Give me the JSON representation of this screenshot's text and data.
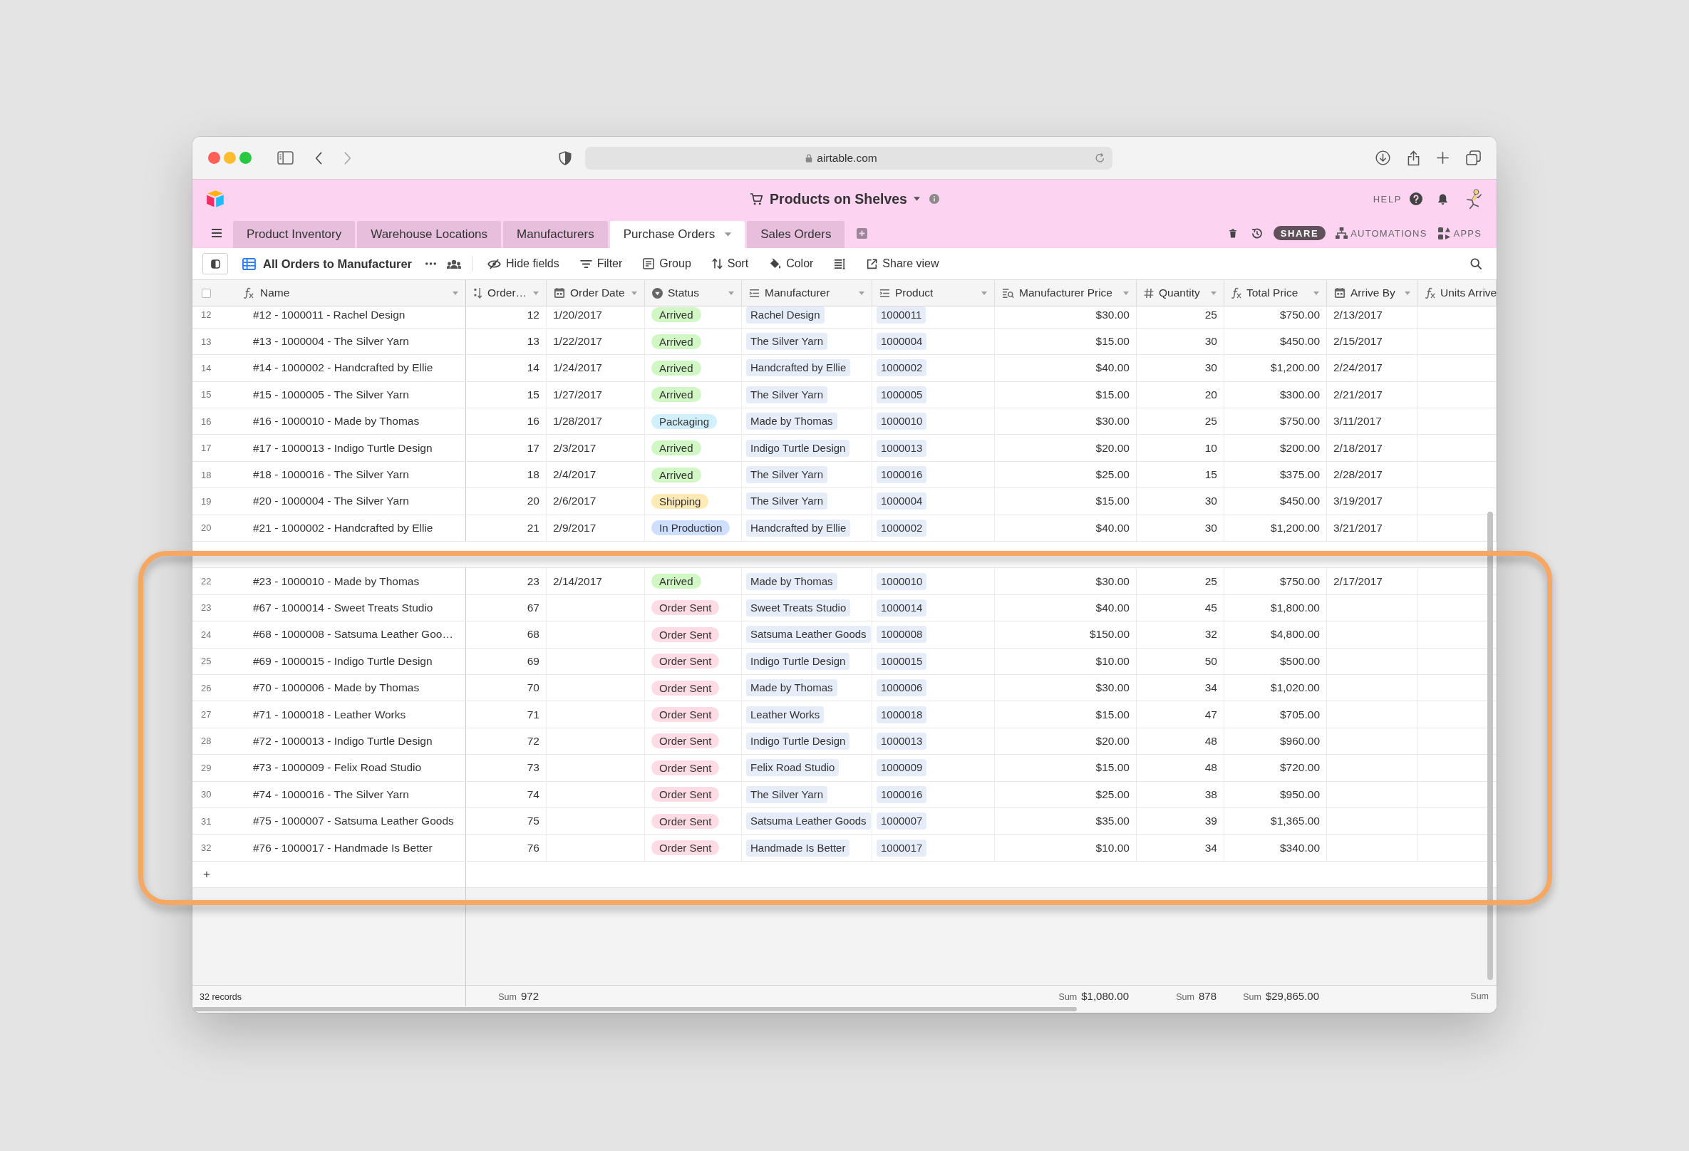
{
  "browser": {
    "url": "airtable.com"
  },
  "header": {
    "title": "Products on Shelves",
    "help": "HELP",
    "share": "SHARE",
    "automations": "AUTOMATIONS",
    "apps": "APPS"
  },
  "tabs": [
    {
      "label": "Product Inventory",
      "selected": false
    },
    {
      "label": "Warehouse Locations",
      "selected": false
    },
    {
      "label": "Manufacturers",
      "selected": false
    },
    {
      "label": "Purchase Orders",
      "selected": true
    },
    {
      "label": "Sales Orders",
      "selected": false
    }
  ],
  "toolbar": {
    "view_name": "All Orders to Manufacturer",
    "buttons": [
      {
        "kind": "hide",
        "label": "Hide fields"
      },
      {
        "kind": "filter",
        "label": "Filter"
      },
      {
        "kind": "group",
        "label": "Group"
      },
      {
        "kind": "sort",
        "label": "Sort"
      },
      {
        "kind": "color",
        "label": "Color"
      },
      {
        "kind": "rowheight"
      },
      {
        "kind": "share",
        "label": "Share view"
      }
    ]
  },
  "table": {
    "select_all": {
      "checked": false
    },
    "columns": [
      {
        "label": "Name",
        "kind": "formula"
      },
      {
        "label": "Order…",
        "kind": "autonumber"
      },
      {
        "label": "Order Date",
        "kind": "date"
      },
      {
        "label": "Status",
        "kind": "select"
      },
      {
        "label": "Manufacturer",
        "kind": "link"
      },
      {
        "label": "Product",
        "kind": "link"
      },
      {
        "label": "Manufacturer Price",
        "kind": "lookup"
      },
      {
        "label": "Quantity",
        "kind": "number"
      },
      {
        "label": "Total Price",
        "kind": "formula"
      },
      {
        "label": "Arrive By",
        "kind": "date"
      },
      {
        "label": "Units Arrive",
        "kind": "formula"
      }
    ],
    "rows": [
      {
        "number": "12",
        "name": "#12 - 1000011 - Rachel Design",
        "order": "12",
        "order_date": "1/20/2017",
        "status": {
          "label": "Arrived",
          "color": "#d1f7c4"
        },
        "manufacturer": "Rachel Design",
        "product": "1000011",
        "manufacturer_price": "$30.00",
        "quantity": "25",
        "total_price": "$750.00",
        "arrive_by": "2/13/2017"
      },
      {
        "number": "13",
        "name": "#13 - 1000004 - The Silver Yarn",
        "order": "13",
        "order_date": "1/22/2017",
        "status": {
          "label": "Arrived",
          "color": "#d1f7c4"
        },
        "manufacturer": "The Silver Yarn",
        "product": "1000004",
        "manufacturer_price": "$15.00",
        "quantity": "30",
        "total_price": "$450.00",
        "arrive_by": "2/15/2017"
      },
      {
        "number": "14",
        "name": "#14 - 1000002 - Handcrafted by Ellie",
        "order": "14",
        "order_date": "1/24/2017",
        "status": {
          "label": "Arrived",
          "color": "#d1f7c4"
        },
        "manufacturer": "Handcrafted by Ellie",
        "product": "1000002",
        "manufacturer_price": "$40.00",
        "quantity": "30",
        "total_price": "$1,200.00",
        "arrive_by": "2/24/2017"
      },
      {
        "number": "15",
        "name": "#15 - 1000005 - The Silver Yarn",
        "order": "15",
        "order_date": "1/27/2017",
        "status": {
          "label": "Arrived",
          "color": "#d1f7c4"
        },
        "manufacturer": "The Silver Yarn",
        "product": "1000005",
        "manufacturer_price": "$15.00",
        "quantity": "20",
        "total_price": "$300.00",
        "arrive_by": "2/21/2017"
      },
      {
        "number": "16",
        "name": "#16 - 1000010 - Made by Thomas",
        "order": "16",
        "order_date": "1/28/2017",
        "status": {
          "label": "Packaging",
          "color": "#d0f0fd"
        },
        "manufacturer": "Made by Thomas",
        "product": "1000010",
        "manufacturer_price": "$30.00",
        "quantity": "25",
        "total_price": "$750.00",
        "arrive_by": "3/11/2017"
      },
      {
        "number": "17",
        "name": "#17 - 1000013 - Indigo Turtle Design",
        "order": "17",
        "order_date": "2/3/2017",
        "status": {
          "label": "Arrived",
          "color": "#d1f7c4"
        },
        "manufacturer": "Indigo Turtle Design",
        "product": "1000013",
        "manufacturer_price": "$20.00",
        "quantity": "10",
        "total_price": "$200.00",
        "arrive_by": "2/18/2017"
      },
      {
        "number": "18",
        "name": "#18 - 1000016 - The Silver Yarn",
        "order": "18",
        "order_date": "2/4/2017",
        "status": {
          "label": "Arrived",
          "color": "#d1f7c4"
        },
        "manufacturer": "The Silver Yarn",
        "product": "1000016",
        "manufacturer_price": "$25.00",
        "quantity": "15",
        "total_price": "$375.00",
        "arrive_by": "2/28/2017"
      },
      {
        "number": "19",
        "name": "#20 - 1000004 - The Silver Yarn",
        "order": "20",
        "order_date": "2/6/2017",
        "status": {
          "label": "Shipping",
          "color": "#ffeab6"
        },
        "manufacturer": "The Silver Yarn",
        "product": "1000004",
        "manufacturer_price": "$15.00",
        "quantity": "30",
        "total_price": "$450.00",
        "arrive_by": "3/19/2017"
      },
      {
        "number": "20",
        "name": "#21 - 1000002 - Handcrafted by Ellie",
        "order": "21",
        "order_date": "2/9/2017",
        "status": {
          "label": "In Production",
          "color": "#cfdfff"
        },
        "manufacturer": "Handcrafted by Ellie",
        "product": "1000002",
        "manufacturer_price": "$40.00",
        "quantity": "30",
        "total_price": "$1,200.00",
        "arrive_by": "3/21/2017"
      },
      {
        "covered": true
      },
      {
        "number": "22",
        "name": "#23 - 1000010 - Made by Thomas",
        "order": "23",
        "order_date": "2/14/2017",
        "status": {
          "label": "Arrived",
          "color": "#d1f7c4"
        },
        "manufacturer": "Made by Thomas",
        "product": "1000010",
        "manufacturer_price": "$30.00",
        "quantity": "25",
        "total_price": "$750.00",
        "arrive_by": "2/17/2017"
      },
      {
        "number": "23",
        "name": "#67 - 1000014 - Sweet Treats Studio",
        "order": "67",
        "status": {
          "label": "Order Sent",
          "color": "#ffdce5"
        },
        "manufacturer": "Sweet Treats Studio",
        "product": "1000014",
        "manufacturer_price": "$40.00",
        "quantity": "45",
        "total_price": "$1,800.00"
      },
      {
        "number": "24",
        "name": "#68 - 1000008 - Satsuma Leather Goo…",
        "order": "68",
        "status": {
          "label": "Order Sent",
          "color": "#ffdce5"
        },
        "manufacturer": "Satsuma Leather Goods",
        "product": "1000008",
        "manufacturer_price": "$150.00",
        "quantity": "32",
        "total_price": "$4,800.00"
      },
      {
        "number": "25",
        "name": "#69 - 1000015 - Indigo Turtle Design",
        "order": "69",
        "status": {
          "label": "Order Sent",
          "color": "#ffdce5"
        },
        "manufacturer": "Indigo Turtle Design",
        "product": "1000015",
        "manufacturer_price": "$10.00",
        "quantity": "50",
        "total_price": "$500.00"
      },
      {
        "number": "26",
        "name": "#70 - 1000006 - Made by Thomas",
        "order": "70",
        "status": {
          "label": "Order Sent",
          "color": "#ffdce5"
        },
        "manufacturer": "Made by Thomas",
        "product": "1000006",
        "manufacturer_price": "$30.00",
        "quantity": "34",
        "total_price": "$1,020.00"
      },
      {
        "number": "27",
        "name": "#71 - 1000018 - Leather Works",
        "order": "71",
        "status": {
          "label": "Order Sent",
          "color": "#ffdce5"
        },
        "manufacturer": "Leather Works",
        "product": "1000018",
        "manufacturer_price": "$15.00",
        "quantity": "47",
        "total_price": "$705.00"
      },
      {
        "number": "28",
        "name": "#72 - 1000013 - Indigo Turtle Design",
        "order": "72",
        "status": {
          "label": "Order Sent",
          "color": "#ffdce5"
        },
        "manufacturer": "Indigo Turtle Design",
        "product": "1000013",
        "manufacturer_price": "$20.00",
        "quantity": "48",
        "total_price": "$960.00"
      },
      {
        "number": "29",
        "name": "#73 - 1000009 - Felix Road Studio",
        "order": "73",
        "status": {
          "label": "Order Sent",
          "color": "#ffdce5"
        },
        "manufacturer": "Felix Road Studio",
        "product": "1000009",
        "manufacturer_price": "$15.00",
        "quantity": "48",
        "total_price": "$720.00"
      },
      {
        "number": "30",
        "name": "#74 - 1000016 - The Silver Yarn",
        "order": "74",
        "status": {
          "label": "Order Sent",
          "color": "#ffdce5"
        },
        "manufacturer": "The Silver Yarn",
        "product": "1000016",
        "manufacturer_price": "$25.00",
        "quantity": "38",
        "total_price": "$950.00"
      },
      {
        "number": "31",
        "name": "#75 - 1000007 - Satsuma Leather Goods",
        "order": "75",
        "status": {
          "label": "Order Sent",
          "color": "#ffdce5"
        },
        "manufacturer": "Satsuma Leather Goods",
        "product": "1000007",
        "manufacturer_price": "$35.00",
        "quantity": "39",
        "total_price": "$1,365.00"
      },
      {
        "number": "32",
        "name": "#76 - 1000017 - Handmade Is Better",
        "order": "76",
        "status": {
          "label": "Order Sent",
          "color": "#ffdce5"
        },
        "manufacturer": "Handmade Is Better",
        "product": "1000017",
        "manufacturer_price": "$10.00",
        "quantity": "34",
        "total_price": "$340.00"
      }
    ],
    "add_row": "+",
    "footer": {
      "records": "32 records",
      "sums": {
        "order": {
          "label": "Sum",
          "value": "972"
        },
        "manufacturer_price": {
          "label": "Sum",
          "value": "$1,080.00"
        },
        "quantity": {
          "label": "Sum",
          "value": "878"
        },
        "total_price": {
          "label": "Sum",
          "value": "$29,865.00"
        },
        "units": {
          "label": "Sum"
        }
      }
    }
  }
}
